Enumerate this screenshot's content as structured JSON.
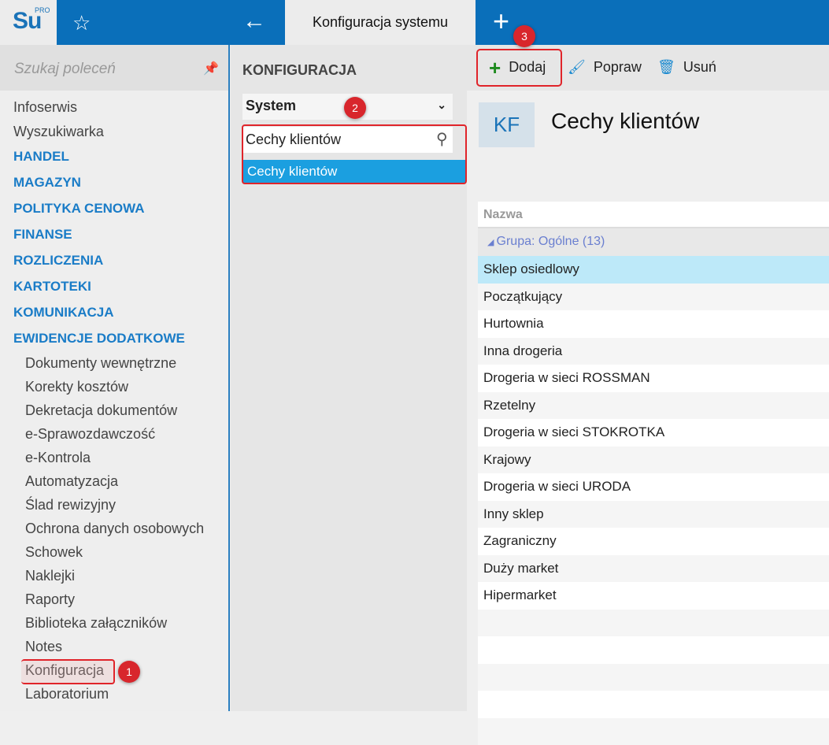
{
  "header": {
    "logo": "Su",
    "logo_sup": "PRO",
    "tab_title": "Konfiguracja systemu"
  },
  "sidebar": {
    "search_placeholder": "Szukaj poleceń",
    "top_items": [
      "Infoserwis",
      "Wyszukiwarka"
    ],
    "categories": [
      "HANDEL",
      "MAGAZYN",
      "POLITYKA CENOWA",
      "FINANSE",
      "ROZLICZENIA",
      "KARTOTEKI",
      "KOMUNIKACJA",
      "EWIDENCJE DODATKOWE"
    ],
    "sub_items": [
      "Dokumenty wewnętrzne",
      "Korekty kosztów",
      "Dekretacja dokumentów",
      "e-Sprawozdawczość",
      "e-Kontrola",
      "Automatyzacja",
      "Ślad rewizyjny",
      "Ochrona danych osobowych",
      "Schowek",
      "Naklejki",
      "Raporty",
      "Biblioteka załączników",
      "Notes",
      "Konfiguracja",
      "Laboratorium"
    ]
  },
  "middle": {
    "title": "KONFIGURACJA",
    "select_value": "System",
    "search_value": "Cechy klientów",
    "result": "Cechy klientów"
  },
  "toolbar": {
    "add": "Dodaj",
    "edit": "Popraw",
    "delete": "Usuń"
  },
  "page": {
    "badge": "KF",
    "title": "Cechy klientów"
  },
  "grid": {
    "column": "Nazwa",
    "group": "Grupa: Ogólne (13)",
    "rows": [
      "Sklep osiedlowy",
      "Początkujący",
      "Hurtownia",
      "Inna drogeria",
      "Drogeria w sieci ROSSMAN",
      "Rzetelny",
      "Drogeria w sieci STOKROTKA",
      "Krajowy",
      "Drogeria w sieci URODA",
      "Inny sklep",
      "Zagraniczny",
      "Duży market",
      "Hipermarket"
    ]
  },
  "annotations": [
    "1",
    "2",
    "3"
  ]
}
